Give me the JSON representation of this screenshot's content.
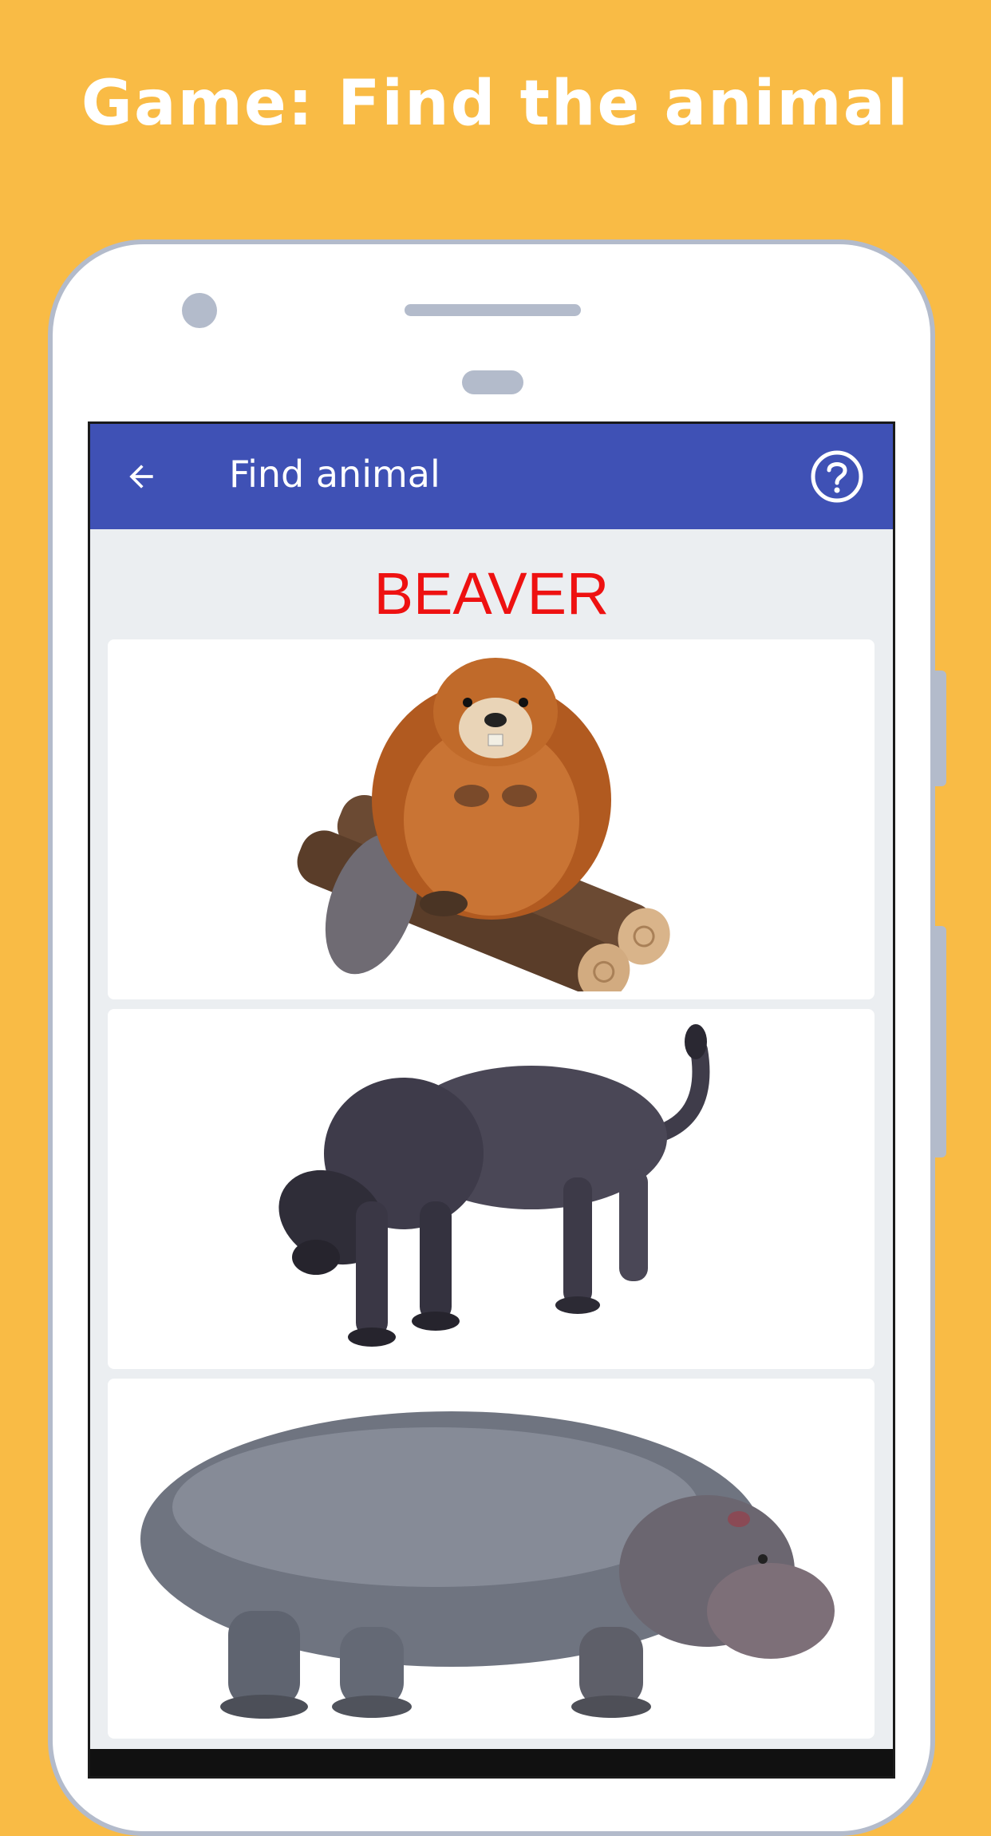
{
  "headline": "Game: Find the animal",
  "appbar": {
    "title": "Find animal",
    "back_icon": "arrow-left-icon",
    "help_icon": "help-circle-icon",
    "color": "#3F51B5"
  },
  "target_word": "BEAVER",
  "target_color": "#EE1111",
  "options": [
    {
      "name": "beaver"
    },
    {
      "name": "panther"
    },
    {
      "name": "hippo"
    }
  ],
  "background_color": "#F9BB45"
}
